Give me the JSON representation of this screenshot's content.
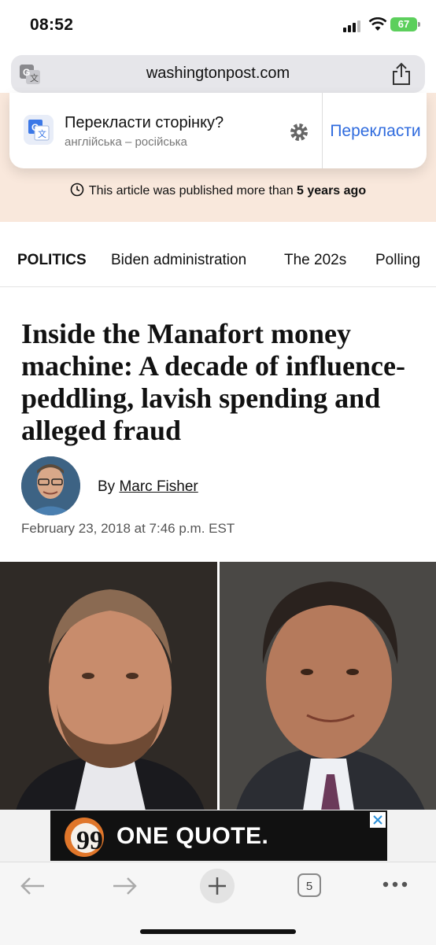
{
  "status_bar": {
    "time": "08:52",
    "battery": "67"
  },
  "browser": {
    "url": "washingtonpost.com"
  },
  "translate_popup": {
    "title": "Перекласти сторінку?",
    "languages": "англійська – російська",
    "action_label": "Перекласти"
  },
  "notice": {
    "text_prefix": "This article was published more than ",
    "text_bold": "5 years ago"
  },
  "section_nav": {
    "items": [
      "POLITICS",
      "Biden administration",
      "The 202s",
      "Polling"
    ]
  },
  "article": {
    "headline": "Inside the Manafort money machine: A decade of influence-peddling, lavish spending and alleged fraud",
    "byline_prefix": "By ",
    "author": "Marc Fisher",
    "date": "February 23, 2018 at 7:46 p.m. EST"
  },
  "ad": {
    "text": "ONE QUOTE."
  },
  "toolbar": {
    "tab_count": "5"
  },
  "colors": {
    "accent_blue": "#2f6bde",
    "notice_bg": "#f9e8dc",
    "battery_green": "#5ccf5c"
  }
}
